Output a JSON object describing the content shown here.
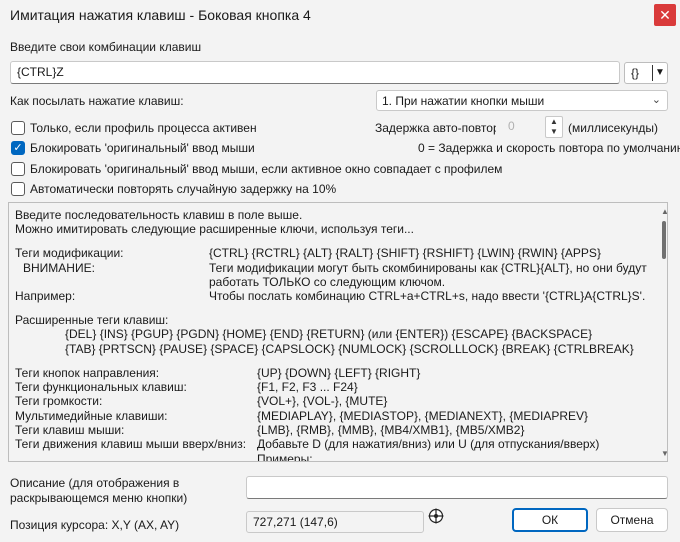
{
  "window": {
    "title": "Имитация нажатия клавиш - Боковая кнопка 4",
    "close_glyph": "✕"
  },
  "keys_section": {
    "label": "Введите свои комбинации клавиш",
    "value": "{CTRL}Z",
    "macro_button_glyph": "{}",
    "macro_button_arrow": "▼"
  },
  "send_mode": {
    "label": "Как посылать нажатие клавиш:",
    "selected": "1. При нажатии кнопки мыши"
  },
  "options": [
    {
      "label": "Только, если профиль процесса активен",
      "checked": false
    },
    {
      "label": "Блокировать 'оригинальный' ввод мыши",
      "checked": true
    },
    {
      "label": "Блокировать 'оригинальный' ввод мыши, если активное окно совпадает с профилем",
      "checked": false
    },
    {
      "label": "Автоматически повторять случайную задержку на 10%",
      "checked": false
    }
  ],
  "repeat_delay": {
    "label": "Задержка авто-повтора",
    "value": "0",
    "unit": "(миллисекунды)",
    "hint": "0 = Задержка и скорость повтора по умолчанию."
  },
  "help": {
    "intro1": "Введите последовательность клавиш в поле выше.",
    "intro2": "Можно имитировать следующие расширенные ключи, используя теги...",
    "mod_label": "Теги модификации:",
    "mod_value": "{CTRL} {RCTRL} {ALT} {RALT} {SHIFT} {RSHIFT} {LWIN} {RWIN} {APPS}",
    "warn_label": "ВНИМАНИЕ:",
    "warn_value1": "Теги модификации могут быть скомбинированы как {CTRL}{ALT}, но они будут",
    "warn_value2": "работать ТОЛЬКО со следующим ключом.",
    "example_label": "Например:",
    "example_value": "Чтобы послать комбинацию CTRL+a+CTRL+s, надо ввести '{CTRL}A{CTRL}S'.",
    "ext_label": "Расширенные теги клавиш:",
    "ext_line1": "{DEL} {INS} {PGUP} {PGDN} {HOME} {END} {RETURN} (или {ENTER}) {ESCAPE} {BACKSPACE}",
    "ext_line2": "{TAB} {PRTSCN} {PAUSE} {SPACE} {CAPSLOCK} {NUMLOCK} {SCROLLLOCK} {BREAK} {CTRLBREAK}",
    "rows": [
      {
        "label": "Теги кнопок направления:",
        "value": "{UP} {DOWN} {LEFT} {RIGHT}"
      },
      {
        "label": "Теги функциональных клавиш:",
        "value": "{F1, F2, F3 ... F24}"
      },
      {
        "label": "Теги громкости:",
        "value": "{VOL+}, {VOL-}, {MUTE}"
      },
      {
        "label": "Мультимедийные клавиши:",
        "value": "{MEDIAPLAY}, {MEDIASTOP}, {MEDIANEXT}, {MEDIAPREV}"
      },
      {
        "label": "Теги клавиш мыши:",
        "value": "{LMB}, {RMB}, {MMB}, {MB4/XMB1}, {MB5/XMB2}"
      },
      {
        "label": "Теги движения клавиш мыши вверх/вниз:",
        "value": "Добавьте D (для нажатия/вниз) или U (для отпускания/вверх)"
      }
    ],
    "cut_line": "Примеры:"
  },
  "description": {
    "label1": "Описание (для отображения в",
    "label2": "раскрывающемся меню кнопки)",
    "value": ""
  },
  "cursor": {
    "label": "Позиция курсора: X,Y (AX, AY)",
    "value": "727,271 (147,6)"
  },
  "buttons": {
    "ok": "ОК",
    "cancel": "Отмена"
  }
}
